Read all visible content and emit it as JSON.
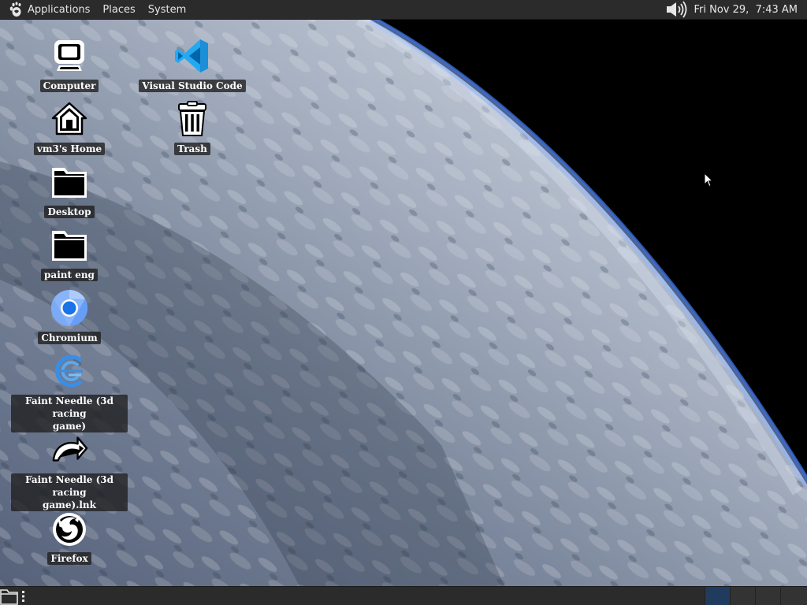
{
  "top_panel": {
    "menus": {
      "applications": "Applications",
      "places": "Places",
      "system": "System"
    },
    "clock": "Fri Nov 29,  7:43 AM",
    "icons": {
      "logo": "gnome-foot-icon",
      "volume": "volume-icon"
    }
  },
  "desktop": {
    "icons": {
      "computer": "Computer",
      "vscode": "Visual Studio Code",
      "home": "vm3's Home",
      "trash": "Trash",
      "desktop_folder": "Desktop",
      "paint_eng": "paint eng",
      "chromium": "Chromium",
      "faint_needle": "Faint Needle (3d racing\ngame)",
      "faint_needle_lnk": "Faint Needle (3d racing\ngame).lnk",
      "firefox": "Firefox"
    }
  },
  "bottom_panel": {
    "workspaces": 4,
    "active_workspace": 1,
    "icons": {
      "show_desktop": "show-desktop-icon"
    }
  },
  "colors": {
    "panel_bg": "#2b2b2b",
    "panel_text": "#e6e6e6",
    "label_bg": "#1e1e1e",
    "vscode_blue": "#23a9f2",
    "chromium_blue": "#4d8de6",
    "active_workspace": "#1f3b5e"
  }
}
